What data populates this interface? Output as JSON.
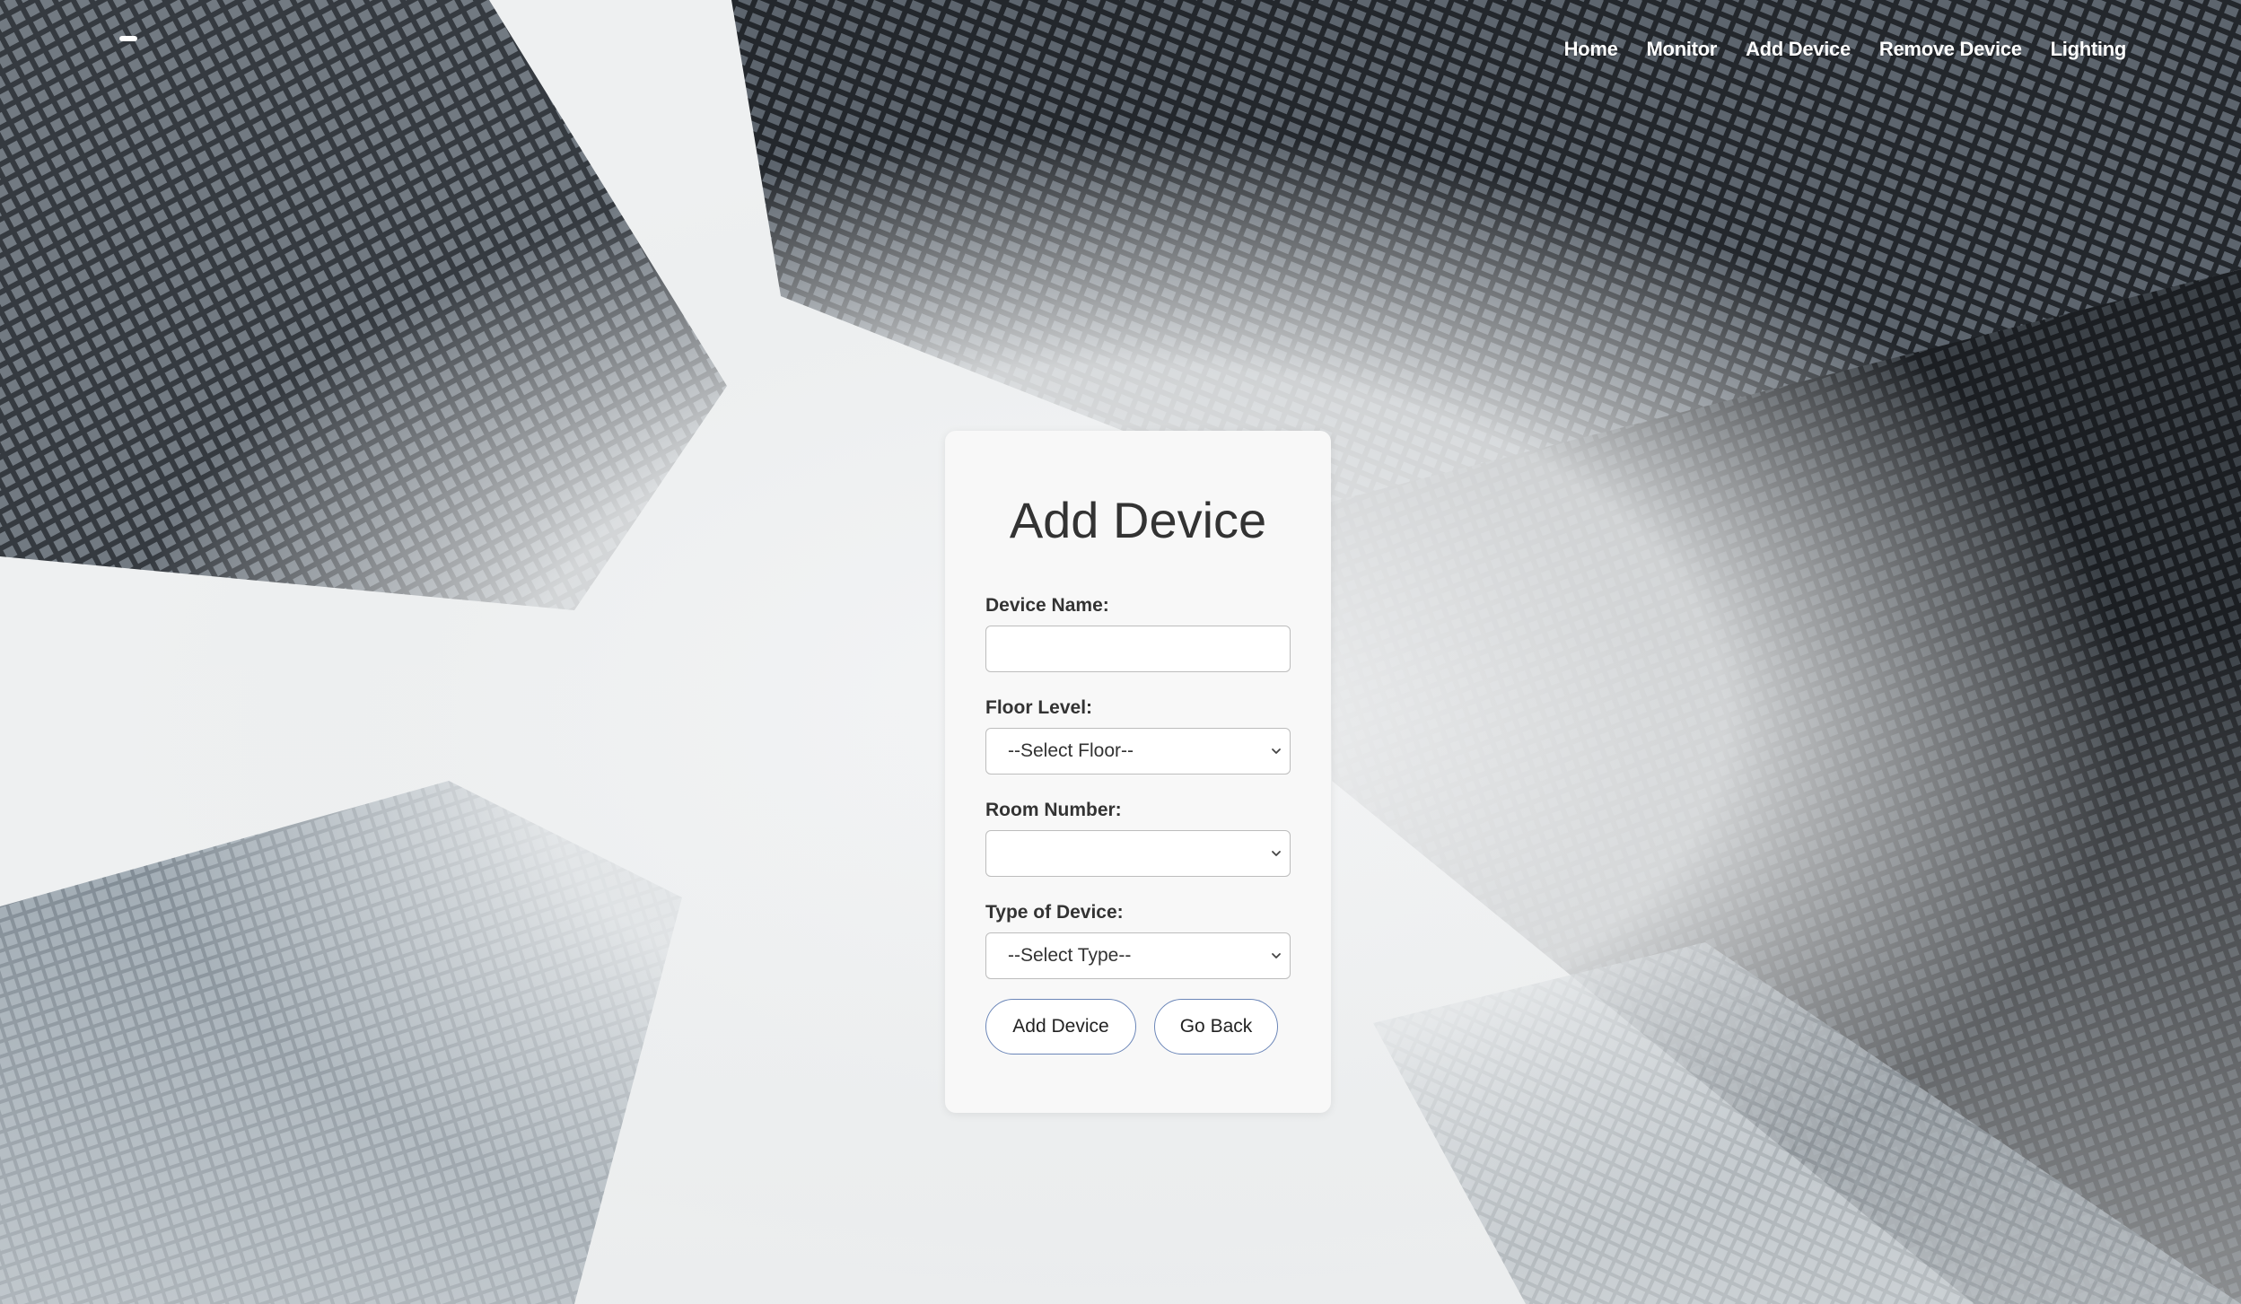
{
  "nav": {
    "items": [
      {
        "label": "Home"
      },
      {
        "label": "Monitor"
      },
      {
        "label": "Add Device"
      },
      {
        "label": "Remove Device"
      },
      {
        "label": "Lighting"
      }
    ]
  },
  "form": {
    "title": "Add Device",
    "device_name": {
      "label": "Device Name:",
      "value": ""
    },
    "floor_level": {
      "label": "Floor Level:",
      "selected": "--Select Floor--"
    },
    "room_number": {
      "label": "Room Number:",
      "selected": ""
    },
    "device_type": {
      "label": "Type of Device:",
      "selected": "--Select Type--"
    },
    "submit_label": "Add Device",
    "back_label": "Go Back"
  },
  "icons": {
    "select_arrow": "chevron-down-icon",
    "logo": "logo-mark"
  }
}
